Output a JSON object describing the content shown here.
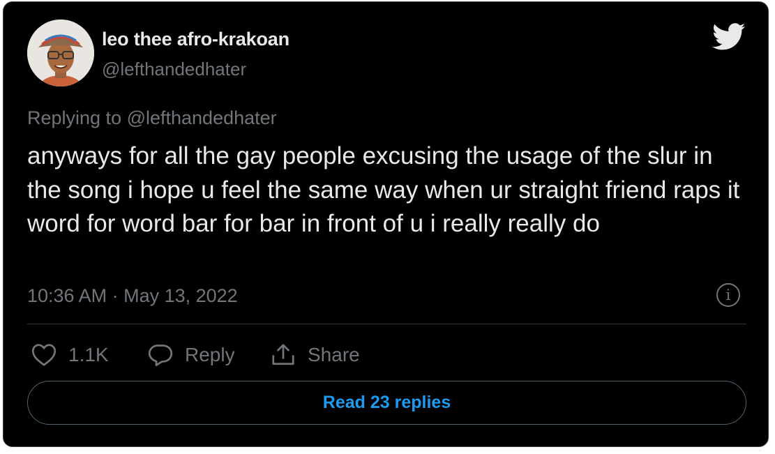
{
  "author": {
    "display_name": "leo thee afro-krakoan",
    "handle": "@lefthandedhater",
    "avatar_icon": "profile-photo"
  },
  "brand": {
    "icon": "twitter-bird-icon",
    "color": "#1d9bf0"
  },
  "tweet": {
    "replying_to": "Replying to @lefthandedhater",
    "text": "anyways for all the gay people excusing the usage of the slur in the song i hope u feel the same way when ur straight friend raps it word for word bar for bar in front of u i really really do",
    "timestamp": "10:36 AM · May 13, 2022"
  },
  "actions": {
    "like_count": "1.1K",
    "reply_label": "Reply",
    "share_label": "Share",
    "read_replies_label": "Read 23 replies"
  },
  "colors": {
    "background": "#000000",
    "text_primary": "#e7e9ea",
    "text_secondary": "#71767b",
    "accent": "#1d9bf0"
  }
}
